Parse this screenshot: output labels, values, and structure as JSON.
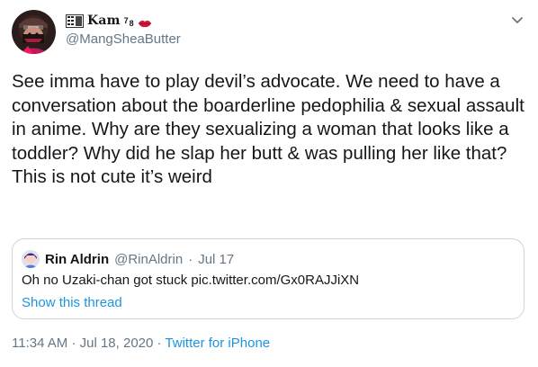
{
  "author": {
    "display_name": "Kam",
    "name_suffix": "7",
    "name_suffix2": "8",
    "handle": "@MangSheaButter"
  },
  "tweet": {
    "text": "See imma have to play devil’s advocate. We need to have a conversation about the boarderline pedophilia & sexual assault in anime. Why are they sexualizing a woman that looks like a toddler? Why did he slap her butt & was pulling her like that? This is not cute it’s weird"
  },
  "quoted_tweet": {
    "display_name": "Rin Aldrin",
    "handle": "@RinAldrin",
    "separator": "·",
    "date": "Jul 17",
    "text": "Oh no Uzaki-chan got stuck pic.twitter.com/Gx0RAJJiXN",
    "show_thread_label": "Show this thread"
  },
  "footer": {
    "time": "11:34 AM",
    "separator": "·",
    "date": "Jul 18, 2020",
    "source": "Twitter for iPhone"
  },
  "colors": {
    "link": "#1b95e0",
    "secondary_text": "#657786",
    "border": "#ccd6dd",
    "lips": "#d4173b"
  },
  "icons": {
    "flag": "flag-icon",
    "lips": "kiss-lips-icon",
    "menu": "chevron-down-icon"
  }
}
